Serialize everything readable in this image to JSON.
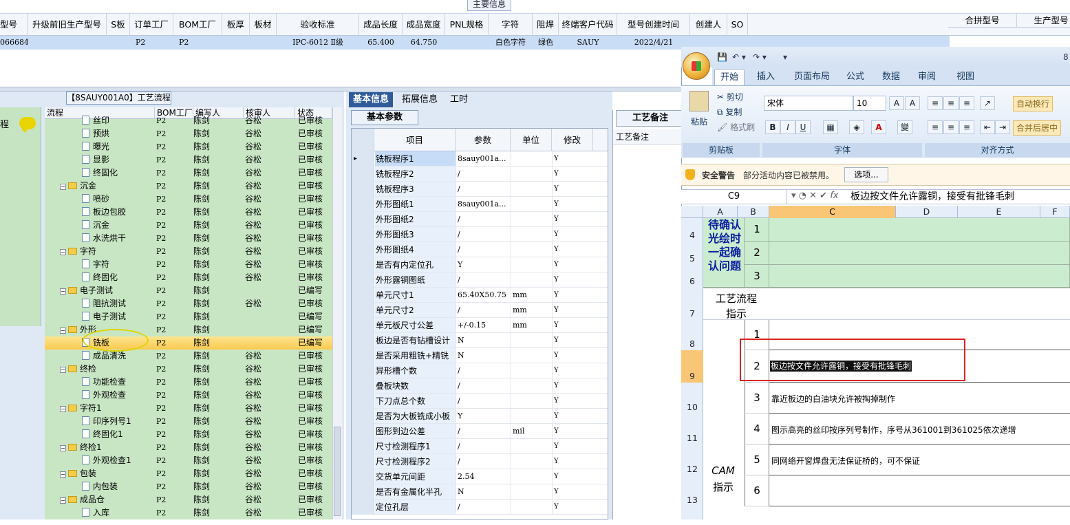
{
  "top": {
    "group_label": "主要信息"
  },
  "grid": {
    "headers": [
      "型号",
      "升级前旧生产型号",
      "S板",
      "订单工厂",
      "BOM工厂",
      "板厚",
      "板材",
      "验收标准",
      "成品长度",
      "成品宽度",
      "PNL规格",
      "字符",
      "阻焊",
      "终端客户代码",
      "型号创建时间",
      "创建人",
      "SO"
    ],
    "right_headers": [
      "合拼型号",
      "生产型号"
    ],
    "row": [
      "066684",
      "",
      "",
      "P2",
      "P2",
      "",
      "",
      "IPC-6012 Ⅱ级",
      "65.400",
      "64.750",
      "",
      "白色字符",
      "绿色",
      "SAUY",
      "2022/4/21",
      "",
      ""
    ]
  },
  "flow": {
    "title": "【8SAUY001A0】工艺流程",
    "side_label": "程",
    "headers": [
      "流程",
      "BOM工厂",
      "编写人",
      "核审人",
      "状态"
    ],
    "rows": [
      {
        "t": "doc",
        "name": "丝印",
        "f": "P2",
        "w": "陈剑",
        "r": "谷松",
        "s": "已审核"
      },
      {
        "t": "doc",
        "name": "预烘",
        "f": "P2",
        "w": "陈剑",
        "r": "谷松",
        "s": "已审核"
      },
      {
        "t": "doc",
        "name": "曝光",
        "f": "P2",
        "w": "陈剑",
        "r": "谷松",
        "s": "已审核"
      },
      {
        "t": "doc",
        "name": "显影",
        "f": "P2",
        "w": "陈剑",
        "r": "谷松",
        "s": "已审核"
      },
      {
        "t": "doc",
        "name": "终固化",
        "f": "P2",
        "w": "陈剑",
        "r": "谷松",
        "s": "已审核"
      },
      {
        "t": "fold",
        "name": "沉金",
        "f": "P2",
        "w": "陈剑",
        "r": "谷松",
        "s": "已审核"
      },
      {
        "t": "doc",
        "name": "喷砂",
        "f": "P2",
        "w": "陈剑",
        "r": "谷松",
        "s": "已审核"
      },
      {
        "t": "doc",
        "name": "板边包胶",
        "f": "P2",
        "w": "陈剑",
        "r": "谷松",
        "s": "已审核"
      },
      {
        "t": "doc",
        "name": "沉金",
        "f": "P2",
        "w": "陈剑",
        "r": "谷松",
        "s": "已审核"
      },
      {
        "t": "doc",
        "name": "水洗烘干",
        "f": "P2",
        "w": "陈剑",
        "r": "谷松",
        "s": "已审核"
      },
      {
        "t": "fold",
        "name": "字符",
        "f": "P2",
        "w": "陈剑",
        "r": "谷松",
        "s": "已审核"
      },
      {
        "t": "doc",
        "name": "字符",
        "f": "P2",
        "w": "陈剑",
        "r": "谷松",
        "s": "已审核"
      },
      {
        "t": "doc",
        "name": "终固化",
        "f": "P2",
        "w": "陈剑",
        "r": "谷松",
        "s": "已审核"
      },
      {
        "t": "fold",
        "name": "电子测试",
        "f": "P2",
        "w": "陈剑",
        "r": "",
        "s": "已编写"
      },
      {
        "t": "doc",
        "name": "阻抗测试",
        "f": "P2",
        "w": "陈剑",
        "r": "谷松",
        "s": "已审核"
      },
      {
        "t": "doc",
        "name": "电子测试",
        "f": "P2",
        "w": "陈剑",
        "r": "",
        "s": "已编写"
      },
      {
        "t": "fold",
        "name": "外形",
        "f": "P2",
        "w": "陈剑",
        "r": "",
        "s": "已编写"
      },
      {
        "t": "doc",
        "name": "铣板",
        "f": "P2",
        "w": "陈剑",
        "r": "",
        "s": "已编写",
        "sel": true
      },
      {
        "t": "doc",
        "name": "成品清洗",
        "f": "P2",
        "w": "陈剑",
        "r": "谷松",
        "s": "已审核"
      },
      {
        "t": "fold",
        "name": "终检",
        "f": "P2",
        "w": "陈剑",
        "r": "谷松",
        "s": "已审核"
      },
      {
        "t": "doc",
        "name": "功能检查",
        "f": "P2",
        "w": "陈剑",
        "r": "谷松",
        "s": "已审核"
      },
      {
        "t": "doc",
        "name": "外观检查",
        "f": "P2",
        "w": "陈剑",
        "r": "谷松",
        "s": "已审核"
      },
      {
        "t": "fold",
        "name": "字符1",
        "f": "P2",
        "w": "陈剑",
        "r": "谷松",
        "s": "已审核"
      },
      {
        "t": "doc",
        "name": "印序列号1",
        "f": "P2",
        "w": "陈剑",
        "r": "谷松",
        "s": "已审核"
      },
      {
        "t": "doc",
        "name": "终固化1",
        "f": "P2",
        "w": "陈剑",
        "r": "谷松",
        "s": "已审核"
      },
      {
        "t": "fold",
        "name": "终检1",
        "f": "P2",
        "w": "陈剑",
        "r": "谷松",
        "s": "已审核"
      },
      {
        "t": "doc",
        "name": "外观检查1",
        "f": "P2",
        "w": "陈剑",
        "r": "谷松",
        "s": "已审核"
      },
      {
        "t": "fold",
        "name": "包装",
        "f": "P2",
        "w": "陈剑",
        "r": "谷松",
        "s": "已审核"
      },
      {
        "t": "doc",
        "name": "内包装",
        "f": "P2",
        "w": "陈剑",
        "r": "谷松",
        "s": "已审核"
      },
      {
        "t": "fold",
        "name": "成品仓",
        "f": "P2",
        "w": "陈剑",
        "r": "谷松",
        "s": "已审核"
      },
      {
        "t": "doc",
        "name": "入库",
        "f": "P2",
        "w": "陈剑",
        "r": "谷松",
        "s": "已审核"
      }
    ]
  },
  "params": {
    "tabs": [
      "基本信息",
      "拓展信息",
      "工时"
    ],
    "subtab": "基本参数",
    "headers": [
      "项目",
      "参数",
      "单位",
      "修改"
    ],
    "rows": [
      [
        "铣板程序1",
        "8sauy001a...",
        "",
        "Y"
      ],
      [
        "铣板程序2",
        "/",
        "",
        "Y"
      ],
      [
        "铣板程序3",
        "/",
        "",
        "Y"
      ],
      [
        "外形图纸1",
        "8sauy001a...",
        "",
        "Y"
      ],
      [
        "外形图纸2",
        "/",
        "",
        "Y"
      ],
      [
        "外形图纸3",
        "/",
        "",
        "Y"
      ],
      [
        "外形图纸4",
        "/",
        "",
        "Y"
      ],
      [
        "是否有内定位孔",
        "Y",
        "",
        "Y"
      ],
      [
        "外形露铜图纸",
        "/",
        "",
        "Y"
      ],
      [
        "单元尺寸1",
        "65.40X50.75",
        "mm",
        "Y"
      ],
      [
        "单元尺寸2",
        "/",
        "mm",
        "Y"
      ],
      [
        "单元板尺寸公差",
        "+/-0.15",
        "mm",
        "Y"
      ],
      [
        "板边是否有钻槽设计",
        "N",
        "",
        "Y"
      ],
      [
        "是否采用粗铣+精铣",
        "N",
        "",
        "Y"
      ],
      [
        "异形槽个数",
        "/",
        "",
        "Y"
      ],
      [
        "叠板块数",
        "/",
        "",
        "Y"
      ],
      [
        "下刀点总个数",
        "/",
        "",
        "Y"
      ],
      [
        "是否为大板铣成小板",
        "Y",
        "",
        "Y"
      ],
      [
        "图形到边公差",
        "/",
        "mil",
        "Y"
      ],
      [
        "尺寸检测程序1",
        "/",
        "",
        "Y"
      ],
      [
        "尺寸检测程序2",
        "/",
        "",
        "Y"
      ],
      [
        "交货单元间距",
        "2.54",
        "",
        "Y"
      ],
      [
        "是否有金属化半孔",
        "N",
        "",
        "Y"
      ],
      [
        "定位孔层",
        "/",
        "",
        "Y"
      ]
    ]
  },
  "notes": {
    "tab": "工艺备注",
    "header": "工艺备注"
  },
  "excel": {
    "qat_number": "8",
    "tabs": [
      "开始",
      "插入",
      "页面布局",
      "公式",
      "数据",
      "审阅",
      "视图"
    ],
    "clipboard": {
      "paste": "粘贴",
      "cut": "剪切",
      "copy": "复制",
      "format": "格式刷",
      "label": "剪贴板"
    },
    "font": {
      "name": "宋体",
      "size": "10",
      "label": "字体"
    },
    "align": {
      "wrap": "自动换行",
      "merge": "合并后居中",
      "label": "对齐方式"
    },
    "security": {
      "title": "安全警告",
      "message": "部分活动内容已被禁用。",
      "button": "选项..."
    },
    "namebox": "C9",
    "formula": "板边按文件允许露铜，接受有批锋毛刺",
    "columns": [
      "A",
      "B",
      "C",
      "D",
      "E",
      "F"
    ],
    "rows": [
      "4",
      "5",
      "6",
      "7",
      "8",
      "9",
      "10",
      "11",
      "12",
      "13"
    ],
    "pending_label": "待确认光绘时一起确认问题",
    "process_label_1": "工艺流程",
    "process_label_2": "指示",
    "cam_1": "CAM",
    "cam_2": "指示",
    "nums": [
      "1",
      "2",
      "3",
      "1",
      "2",
      "3",
      "4",
      "5",
      "6"
    ],
    "texts": [
      "",
      "板边按文件允许露铜，接受有批锋毛刺",
      "靠近板边的白油块允许被掏掉制作",
      "图示高亮的丝印按序列号制作，序号从361001到361025依次递增",
      "同网络开窗焊盘无法保证桥的，可不保证",
      ""
    ]
  }
}
